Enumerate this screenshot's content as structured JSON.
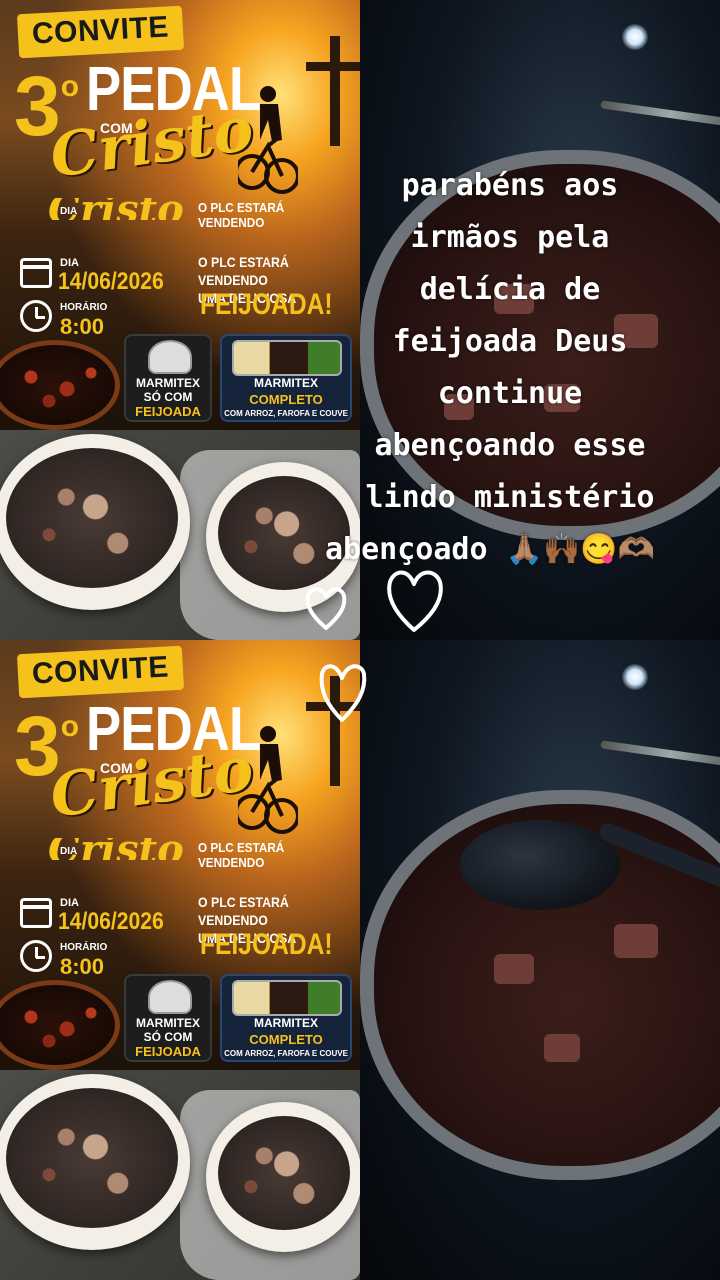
{
  "poster": {
    "convite": "CONVITE",
    "number": "3",
    "ordinal": "o",
    "pedal": "PEDAL",
    "com": "COM",
    "cristo": "Cristo",
    "dia_label": "DIA",
    "plc_line_1": "O PLC ESTARÁ VENDENDO",
    "dia": "DIA",
    "date": "14/06/2026",
    "horario_label": "HORÁRIO",
    "time": "8:00",
    "plc_line_2a": "O PLC ESTARÁ VENDENDO",
    "plc_line_2b": "UMA DELICIOSA",
    "feijoada": "FEIJOADA!",
    "marmitex_1": {
      "title": "MARMITEX",
      "line1": "SÓ COM",
      "line2": "FEIJOADA"
    },
    "marmitex_2": {
      "title": "MARMITEX",
      "line1": "COMPLETO",
      "line2": "COM ARROZ, FAROFA E COUVE"
    }
  },
  "caption": {
    "lines": [
      "parabéns aos",
      "irmãos pela",
      "delícia de",
      "feijoada Deus",
      "continue",
      "abençoando esse",
      "lindo ministério",
      "abençoado 🙏🏽🙌🏾😋🫶🏽"
    ]
  },
  "colors": {
    "accent_yellow": "#f5c21b",
    "caption_text": "#ffffff",
    "background": "#111111"
  },
  "icons": [
    "calendar-icon",
    "clock-icon",
    "heart-outline-icon",
    "cross-icon",
    "cyclist-icon"
  ]
}
